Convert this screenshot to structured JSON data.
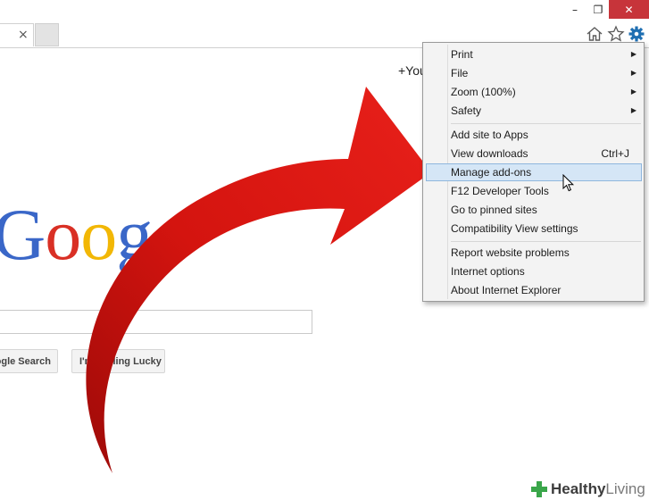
{
  "tabs": [
    {
      "close_glyph": "×"
    }
  ],
  "window_controls": {
    "minimize": "–",
    "restore": "❐",
    "close": "✕"
  },
  "command_bar": {
    "icons": [
      "home-icon",
      "favorites-star-icon",
      "tools-gear-icon"
    ],
    "accent_color": "#1f6fb2"
  },
  "google_page": {
    "account_link": "+You",
    "logo_letters": [
      {
        "ch": "G",
        "color": "#3a67c8"
      },
      {
        "ch": "o",
        "color": "#d93025"
      },
      {
        "ch": "o",
        "color": "#f2b705"
      },
      {
        "ch": "g",
        "color": "#3a67c8"
      }
    ],
    "search_button": "Google Search",
    "lucky_button": "I'm Feeling Lucky"
  },
  "tools_menu": {
    "items": [
      {
        "label": "Print",
        "submenu": true
      },
      {
        "label": "File",
        "submenu": true
      },
      {
        "label": "Zoom (100%)",
        "submenu": true
      },
      {
        "label": "Safety",
        "submenu": true
      },
      {
        "label": "Add site to Apps"
      },
      {
        "label": "View downloads",
        "shortcut": "Ctrl+J"
      },
      {
        "label": "Manage add-ons",
        "highlighted": true
      },
      {
        "label": "F12 Developer Tools"
      },
      {
        "label": "Go to pinned sites"
      },
      {
        "label": "Compatibility View settings"
      },
      {
        "label": "Report website problems"
      },
      {
        "label": "Internet options"
      },
      {
        "label": "About Internet Explorer"
      }
    ],
    "submenu_glyph": "▶",
    "highlight_color": "#d5e6f6"
  },
  "overlay": {
    "arrow_color": "#d4140f"
  },
  "watermark": {
    "brand_a": "Healthy",
    "brand_b": " Living",
    "cross_color": "#3aa64a"
  }
}
